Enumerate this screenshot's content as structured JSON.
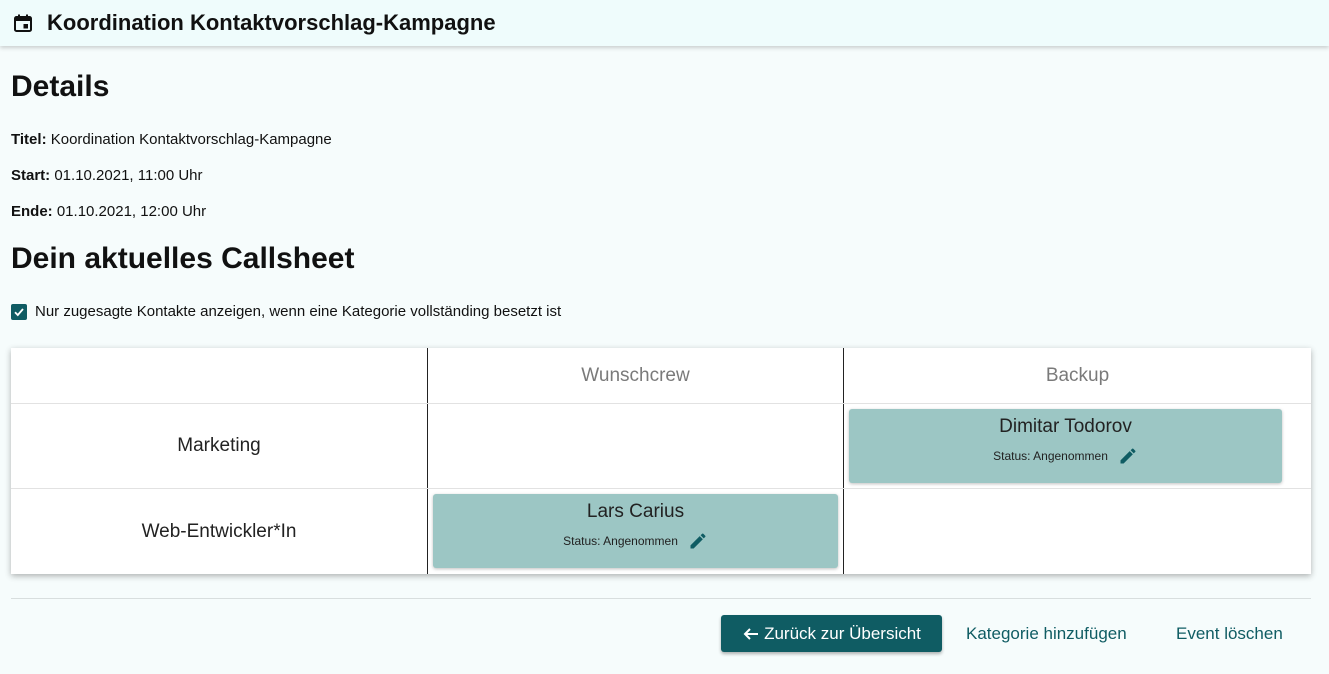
{
  "header": {
    "icon": "calendar-icon",
    "title": "Koordination Kontaktvorschlag-Kampagne"
  },
  "details": {
    "heading": "Details",
    "title_label": "Titel:",
    "title_value": "Koordination Kontaktvorschlag-Kampagne",
    "start_label": "Start:",
    "start_value": "01.10.2021, 11:00 Uhr",
    "end_label": "Ende:",
    "end_value": "01.10.2021, 12:00 Uhr"
  },
  "callsheet": {
    "heading": "Dein aktuelles Callsheet",
    "checkbox_label": "Nur zugesagte Kontakte anzeigen, wenn eine Kategorie vollständing besetzt ist",
    "checkbox_checked": true,
    "columns": [
      "",
      "Wunschcrew",
      "Backup"
    ],
    "rows": [
      {
        "category": "Marketing",
        "wunschcrew": null,
        "backup": {
          "name": "Dimitar Todorov",
          "status": "Status: Angenommen"
        }
      },
      {
        "category": "Web-Entwickler*In",
        "wunschcrew": {
          "name": "Lars Carius",
          "status": "Status: Angenommen"
        },
        "backup": null
      }
    ]
  },
  "actions": {
    "back_label": "Zurück zur Übersicht",
    "add_category_label": "Kategorie hinzufügen",
    "delete_event_label": "Event löschen"
  },
  "colors": {
    "primary": "#0f5c63",
    "card": "#9cc6c4",
    "background": "#f6fcfc",
    "header": "#effcfc"
  }
}
